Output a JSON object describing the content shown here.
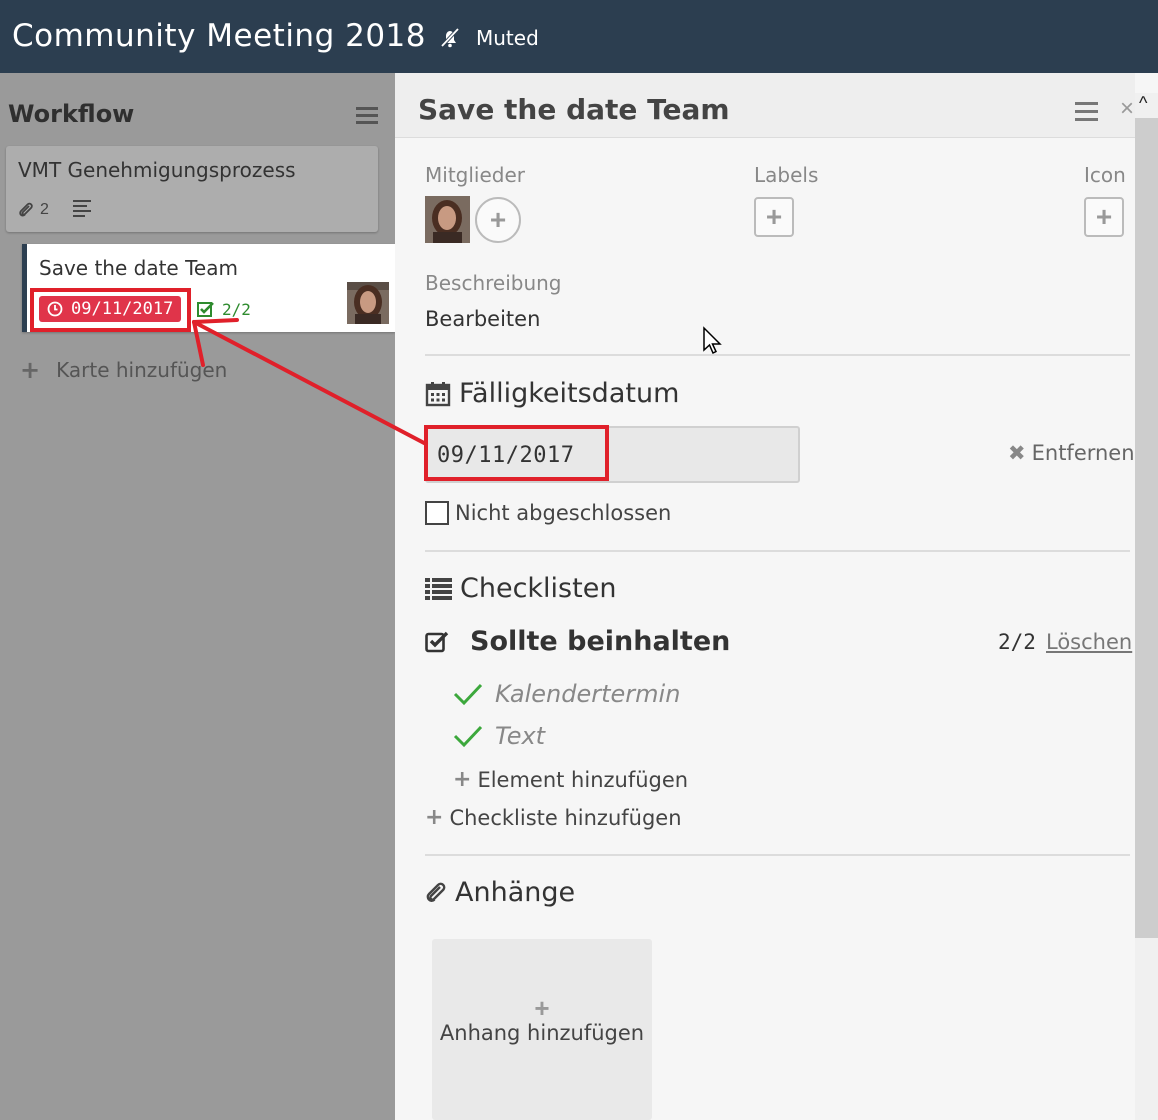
{
  "header": {
    "board_title": "Community Meeting 2018",
    "muted_label": "Muted",
    "muted_icon": "bell-slash-icon",
    "bg_color": "#2c3e50"
  },
  "list": {
    "title": "Workflow",
    "cards": [
      {
        "title": "VMT Genehmigungsprozess",
        "attachments": "2"
      },
      {
        "title": "Save the date Team",
        "due": "09/11/2017",
        "checklist": "2/2"
      }
    ],
    "add_card_label": "Karte hinzufügen"
  },
  "detail": {
    "title": "Save the date Team",
    "members_label": "Mitglieder",
    "labels_label": "Labels",
    "icon_label": "Icon",
    "description_label": "Beschreibung",
    "description_edit": "Bearbeiten",
    "due_section": "Fälligkeitsdatum",
    "due_value": "09/11/2017",
    "remove_label": "Entfernen",
    "not_completed_label": "Nicht abgeschlossen",
    "checklists_section": "Checklisten",
    "checklist": {
      "title": "Sollte beinhalten",
      "count": "2/2",
      "delete_label": "Löschen",
      "items": [
        "Kalendertermin",
        "Text"
      ],
      "add_item_label": "Element hinzufügen"
    },
    "add_checklist_label": "Checkliste hinzufügen",
    "attachments_section": "Anhänge",
    "add_attachment_label": "Anhang hinzufügen"
  },
  "colors": {
    "due_badge": "#e0344a",
    "annotation": "#e0202a",
    "check_green": "#2e9b2e"
  }
}
